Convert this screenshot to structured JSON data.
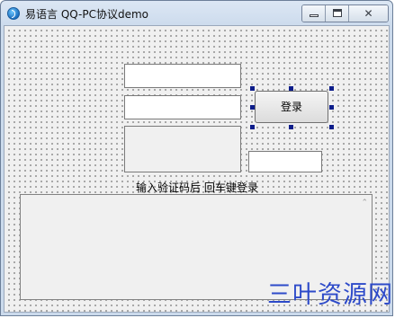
{
  "window": {
    "title": "易语言 QQ-PC协议demo",
    "icon": "easy-language-icon",
    "controls": {
      "minimize": "minimize-icon",
      "maximize": "maximize-icon",
      "close": "close-icon",
      "close_glyph": "✕"
    }
  },
  "form": {
    "account_value": "",
    "password_value": "",
    "captcha_code_value": "",
    "login_button_label": "登录",
    "hint_text": "输入验证码后 回车键登录",
    "log_text": ""
  },
  "watermark": {
    "text": "三叶资源网",
    "color": "#2d4ac9"
  }
}
